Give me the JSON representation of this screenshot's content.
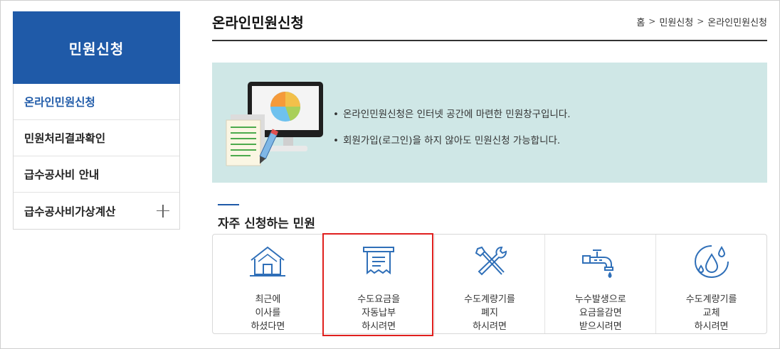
{
  "sidebar": {
    "header": "민원신청",
    "items": [
      {
        "label": "온라인민원신청"
      },
      {
        "label": "민원처리결과확인"
      },
      {
        "label": "급수공사비 안내"
      },
      {
        "label": "급수공사비가상계산"
      }
    ]
  },
  "header": {
    "title": "온라인민원신청",
    "breadcrumb": [
      "홈",
      "민원신청",
      "온라인민원신청"
    ]
  },
  "banner": {
    "lines": [
      "온라인민원신청은 인터넷 공간에 마련한 민원창구입니다.",
      "회원가입(로그인)을 하지 않아도 민원신청 가능합니다."
    ]
  },
  "faq": {
    "title": "자주 신청하는 민원",
    "cards": [
      {
        "label": "최근에\n이사를\n하셨다면",
        "icon": "house-icon"
      },
      {
        "label": "수도요금을\n자동납부\n하시려면",
        "icon": "receipt-icon"
      },
      {
        "label": "수도계량기를\n폐지\n하시려면",
        "icon": "tools-icon"
      },
      {
        "label": "누수발생으로\n요금을감면\n받으시려면",
        "icon": "faucet-icon"
      },
      {
        "label": "수도계량기를\n교체\n하시려면",
        "icon": "water-drops-icon"
      }
    ]
  },
  "colors": {
    "brand": "#1f5aa8",
    "banner_bg": "#cfe7e6",
    "highlight": "#e0201e",
    "icon": "#2f6fb8"
  }
}
